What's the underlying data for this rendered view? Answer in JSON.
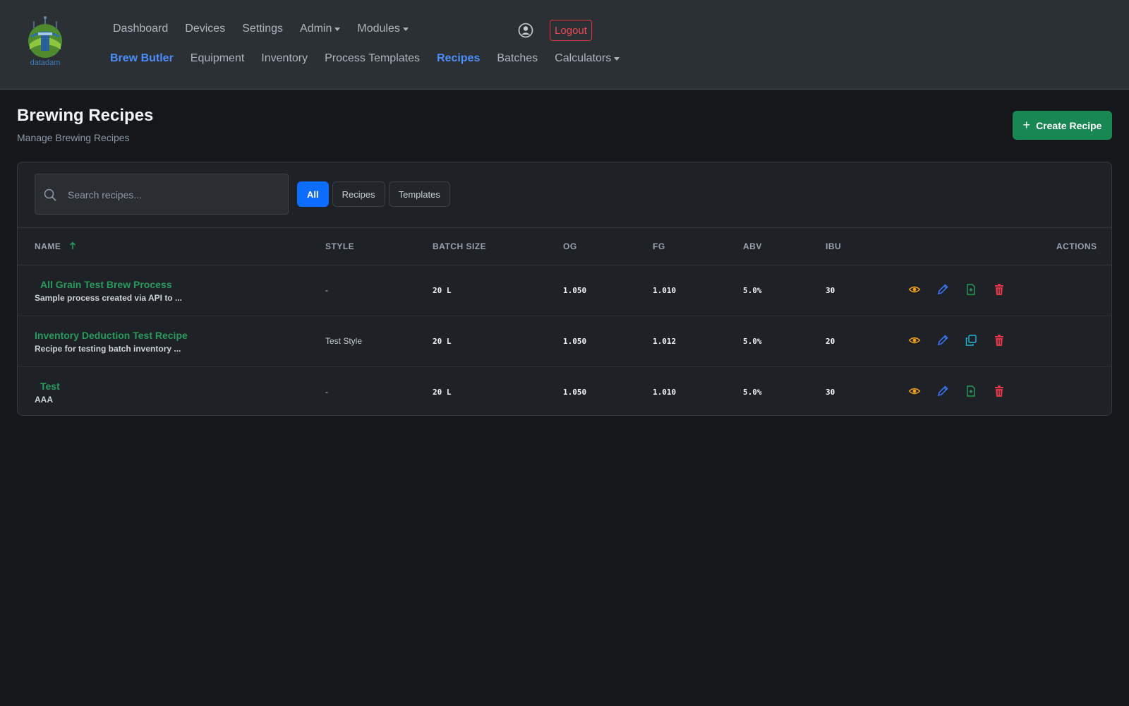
{
  "nav": {
    "top": [
      {
        "label": "Dashboard",
        "caret": false
      },
      {
        "label": "Devices",
        "caret": false
      },
      {
        "label": "Settings",
        "caret": false
      },
      {
        "label": "Admin",
        "caret": true
      },
      {
        "label": "Modules",
        "caret": true
      }
    ],
    "sub": [
      {
        "label": "Brew Butler",
        "active": true
      },
      {
        "label": "Equipment",
        "active": false
      },
      {
        "label": "Inventory",
        "active": false
      },
      {
        "label": "Process Templates",
        "active": false
      },
      {
        "label": "Recipes",
        "active": true
      },
      {
        "label": "Batches",
        "active": false
      },
      {
        "label": "Calculators",
        "active": false,
        "caret": true
      }
    ],
    "logout": "Logout",
    "logo_text": "datadam"
  },
  "page": {
    "title": "Brewing Recipes",
    "subtitle": "Manage Brewing Recipes",
    "create_label": "Create Recipe"
  },
  "search": {
    "placeholder": "Search recipes..."
  },
  "filters": [
    {
      "label": "All",
      "active": true
    },
    {
      "label": "Recipes",
      "active": false
    },
    {
      "label": "Templates",
      "active": false
    }
  ],
  "table": {
    "headers": {
      "name": "NAME",
      "style": "STYLE",
      "batch_size": "BATCH SIZE",
      "og": "OG",
      "fg": "FG",
      "abv": "ABV",
      "ibu": "IBU",
      "actions": "ACTIONS"
    },
    "sort": {
      "column": "name",
      "direction": "ascending"
    },
    "rows": [
      {
        "name": "All Grain Test Brew Process",
        "description": "Sample process created via API to ...",
        "style": "-",
        "batch_size": "20 L",
        "og": "1.050",
        "fg": "1.010",
        "abv": "5.0%",
        "ibu": "30",
        "third_action": "file-plus-icon"
      },
      {
        "name": "Inventory Deduction Test Recipe",
        "description": "Recipe for testing batch inventory ...",
        "style": "Test Style",
        "batch_size": "20 L",
        "og": "1.050",
        "fg": "1.012",
        "abv": "5.0%",
        "ibu": "20",
        "third_action": "copy-icon"
      },
      {
        "name": "Test",
        "description": "AAA",
        "style": "-",
        "batch_size": "20 L",
        "og": "1.050",
        "fg": "1.010",
        "abv": "5.0%",
        "ibu": "30",
        "third_action": "file-plus-icon"
      }
    ]
  },
  "colors": {
    "brand_green": "#198754",
    "link_blue": "#4d8df7",
    "danger": "#dc3545",
    "view_icon": "#f0a020",
    "edit_icon": "#3d7bff",
    "copy_icon": "#20b8d8"
  }
}
